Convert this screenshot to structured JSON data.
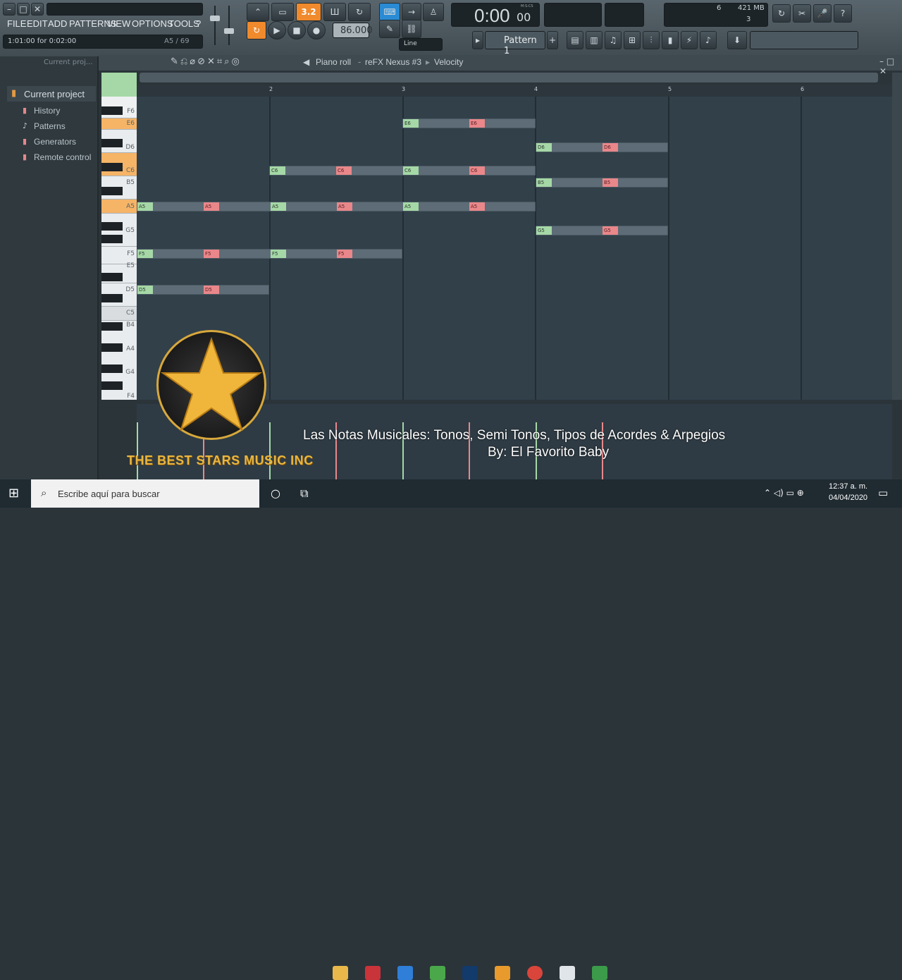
{
  "menu": [
    "FILE",
    "EDIT",
    "ADD",
    "PATTERNS",
    "VIEW",
    "OPTIONS",
    "TOOLS",
    "?"
  ],
  "hint_bar": {
    "left": "1:01:00 for 0:02:00",
    "right": "A5 / 69"
  },
  "transport": {
    "time": "0:00",
    "time_small": "00",
    "tempo": "86.000",
    "pattern": "Pattern 1",
    "snap": "Line",
    "mscs": "M:S:CS"
  },
  "monitor": {
    "cpu": "6",
    "mem": "421 MB",
    "poly": "3"
  },
  "browser": {
    "title": "Current proj...",
    "items": [
      "Current project",
      "History",
      "Patterns",
      "Generators",
      "Remote control"
    ]
  },
  "pianoroll": {
    "breadcrumb": [
      "Piano roll",
      "reFX Nexus #3",
      "Velocity"
    ]
  },
  "ruler": [
    "2",
    "3",
    "4",
    "5",
    "6"
  ],
  "keys": [
    "F6",
    "E6",
    "D6",
    "C6",
    "B5",
    "A5",
    "G5",
    "F5",
    "E5",
    "D5",
    "C5",
    "B4",
    "A4",
    "G4",
    "F4"
  ],
  "notes": [
    {
      "label": "E6",
      "color": "g"
    },
    {
      "label": "E6",
      "color": "r"
    },
    {
      "label": "D6",
      "color": "g"
    },
    {
      "label": "D6",
      "color": "r"
    },
    {
      "label": "C6",
      "color": "g"
    },
    {
      "label": "C6",
      "color": "r"
    },
    {
      "label": "C6",
      "color": "g"
    },
    {
      "label": "C6",
      "color": "r"
    },
    {
      "label": "B5",
      "color": "g"
    },
    {
      "label": "B5",
      "color": "r"
    },
    {
      "label": "A5",
      "color": "g"
    },
    {
      "label": "A5",
      "color": "r"
    },
    {
      "label": "A5",
      "color": "g"
    },
    {
      "label": "A5",
      "color": "r"
    },
    {
      "label": "A5",
      "color": "g"
    },
    {
      "label": "A5",
      "color": "r"
    },
    {
      "label": "G5",
      "color": "g"
    },
    {
      "label": "G5",
      "color": "r"
    },
    {
      "label": "F5",
      "color": "g"
    },
    {
      "label": "F5",
      "color": "r"
    },
    {
      "label": "F5",
      "color": "g"
    },
    {
      "label": "F5",
      "color": "r"
    },
    {
      "label": "D5",
      "color": "g"
    },
    {
      "label": "D5",
      "color": "r"
    }
  ],
  "overlay": {
    "caption_line1": "Las Notas Musicales: Tonos, Semi Tonos, Tipos de Acordes & Arpegios",
    "caption_line2": "By: El Favorito Baby",
    "logo_text": "THE BEST STARS MUSIC INC"
  },
  "taskbar": {
    "search_placeholder": "Escribe aquí para buscar",
    "time": "12:37 a. m.",
    "date": "04/04/2020"
  },
  "colors": {
    "note_green": "#a5d8a6",
    "note_red": "#e9878a",
    "accent_orange": "#f08a2c",
    "grid_bg": "#32404a"
  }
}
